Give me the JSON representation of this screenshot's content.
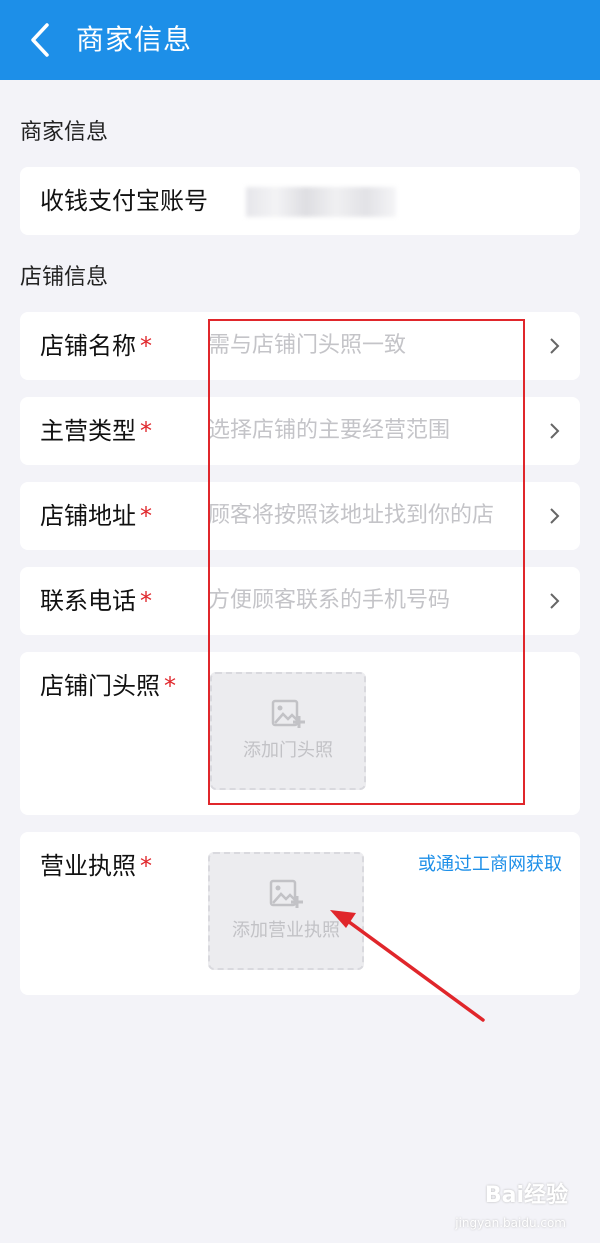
{
  "header": {
    "title": "商家信息"
  },
  "merchant": {
    "section_label": "商家信息",
    "alipay_label": "收钱支付宝账号"
  },
  "store": {
    "section_label": "店铺信息",
    "rows": [
      {
        "label": "店铺名称",
        "required": "*",
        "placeholder": "需与店铺门头照一致"
      },
      {
        "label": "主营类型",
        "required": "*",
        "placeholder": "选择店铺的主要经营范围"
      },
      {
        "label": "店铺地址",
        "required": "*",
        "placeholder": "顾客将按照该地址找到你的店"
      },
      {
        "label": "联系电话",
        "required": "*",
        "placeholder": "方便顾客联系的手机号码"
      }
    ],
    "storefront": {
      "label": "店铺门头照",
      "required": "*",
      "upload_label": "添加门头照"
    }
  },
  "license": {
    "label": "营业执照",
    "required": "*",
    "upload_label": "添加营业执照",
    "link": "或通过工商网获取"
  },
  "watermark": {
    "brand": "Bai经验",
    "url": "jingyan.baidu.com"
  },
  "colors": {
    "accent": "#1d8fe8",
    "required": "#e0262b",
    "annotation": "#e0262b"
  }
}
